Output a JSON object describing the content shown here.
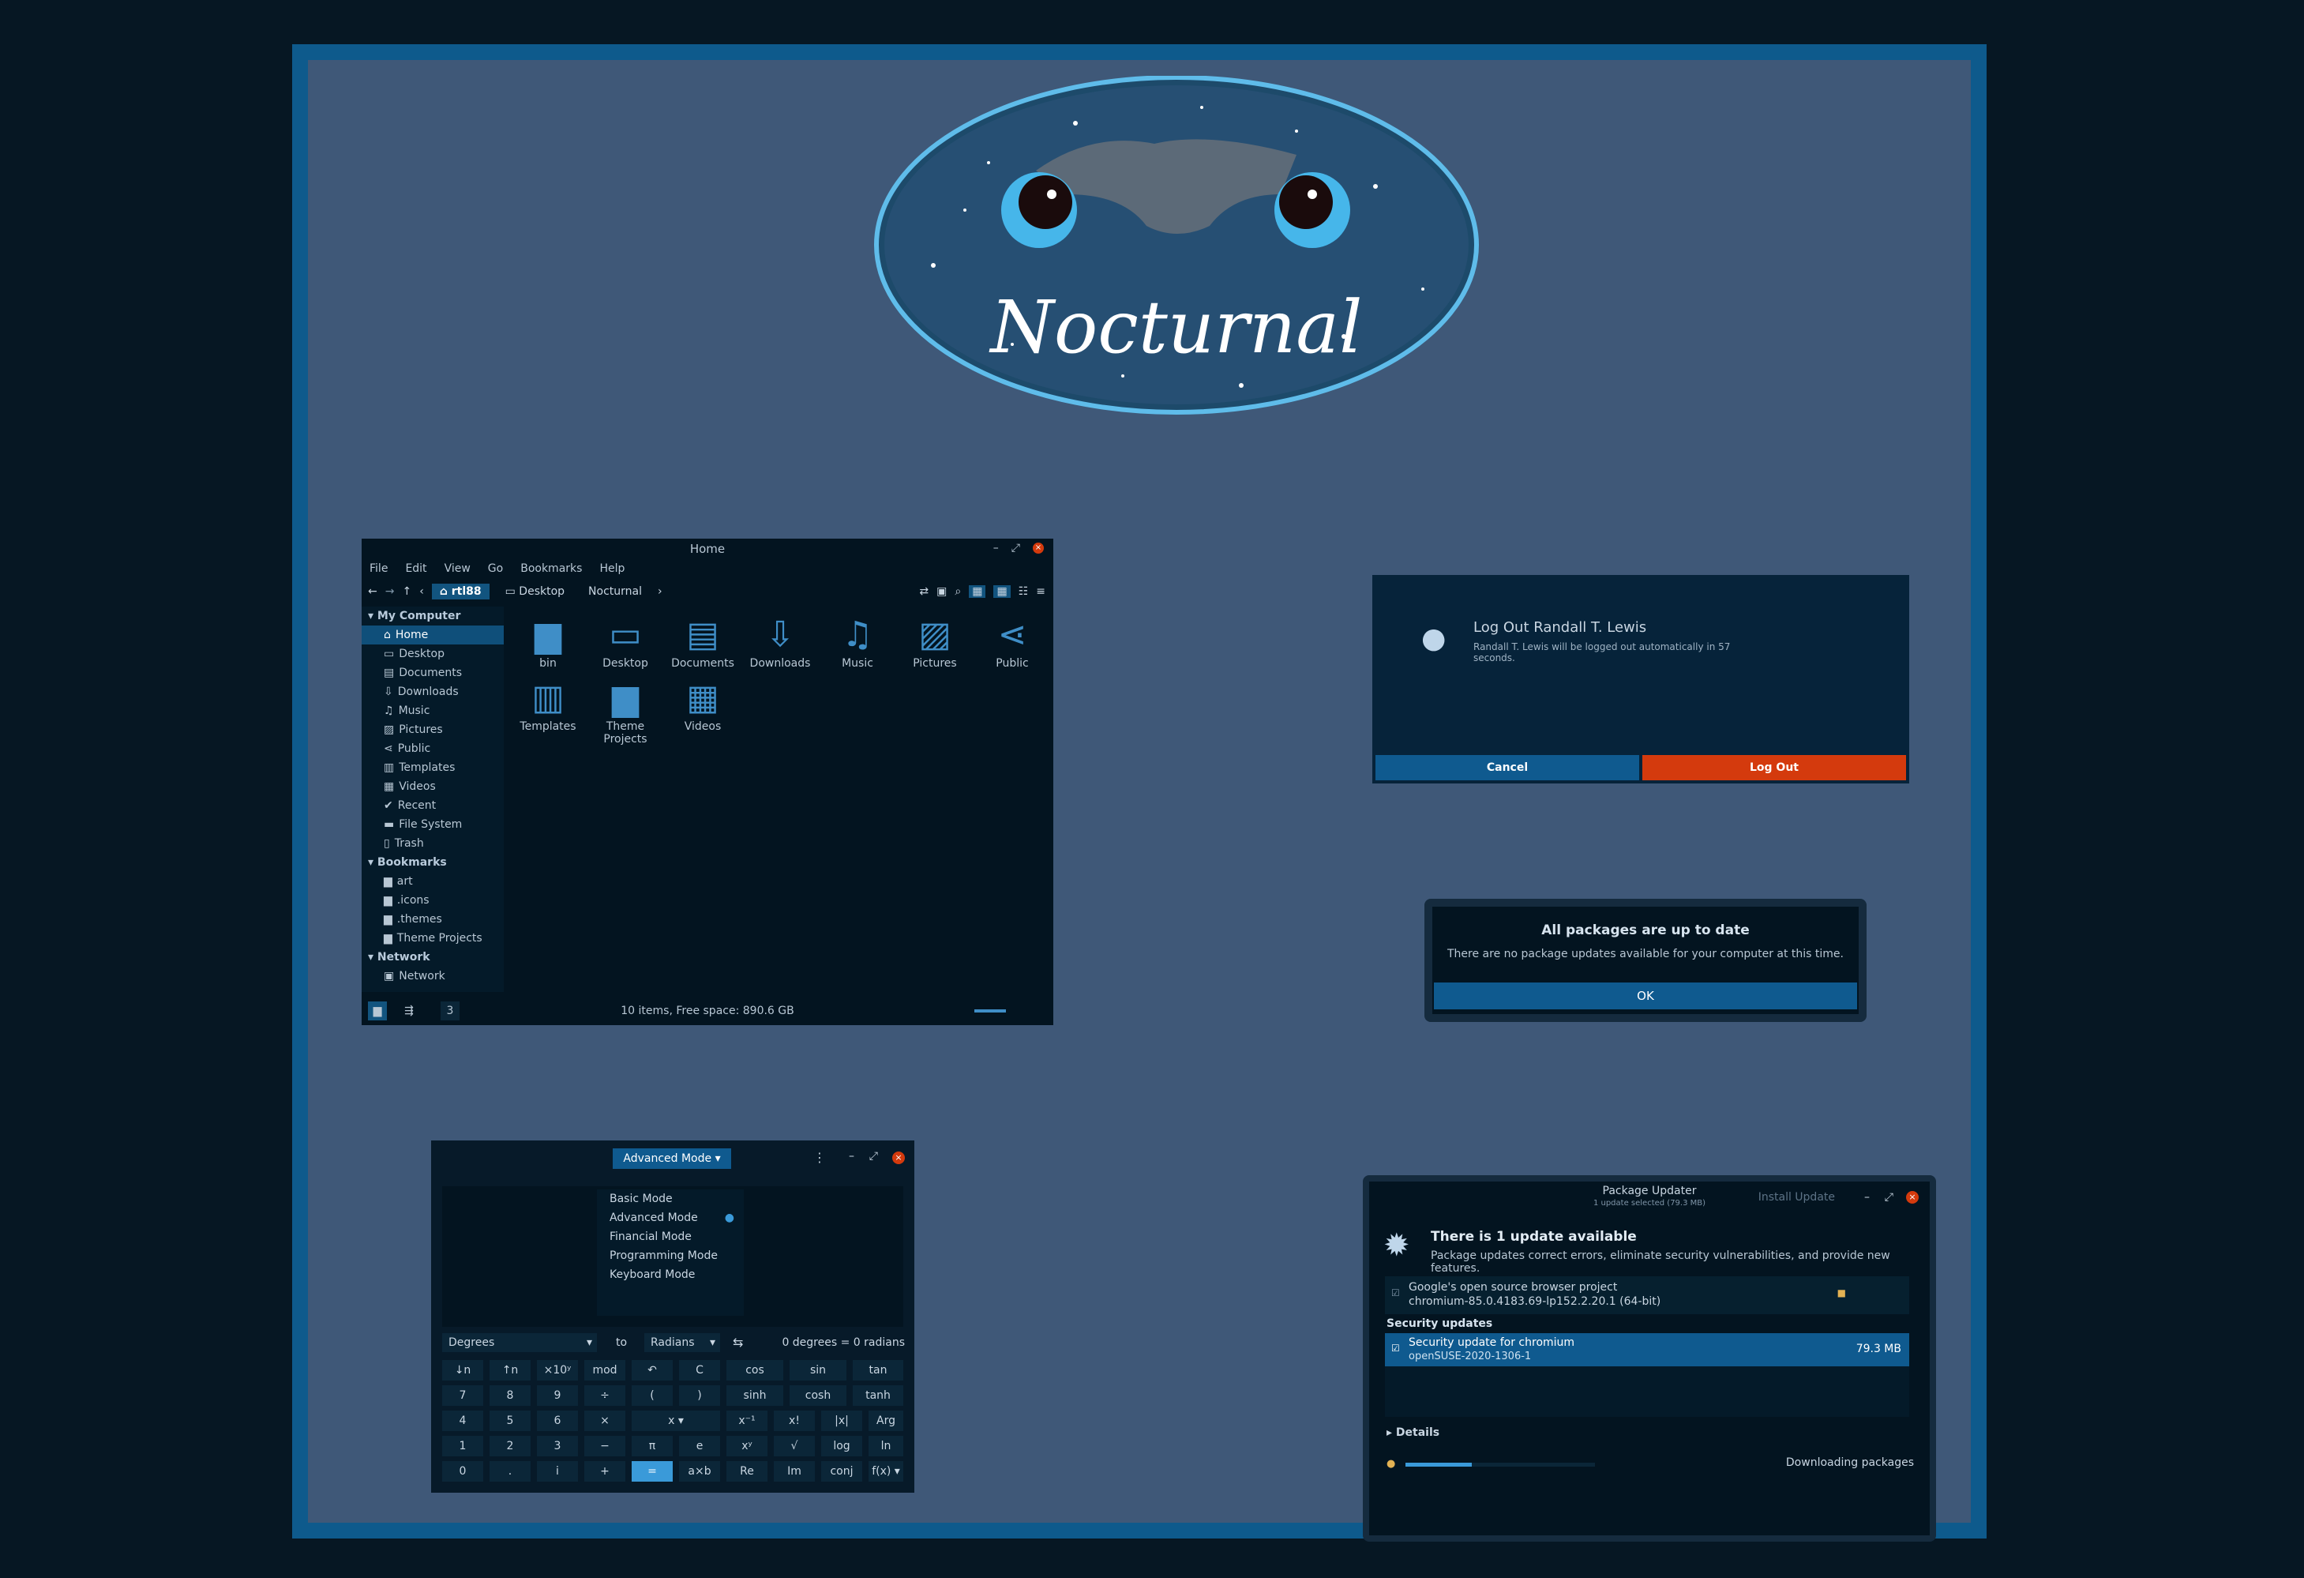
{
  "logo": {
    "text": "Nocturnal"
  },
  "file_manager": {
    "title": "Home",
    "menu": [
      "File",
      "Edit",
      "View",
      "Go",
      "Bookmarks",
      "Help"
    ],
    "breadcrumbs": [
      "rtl88",
      "Desktop",
      "Nocturnal"
    ],
    "sidebar": {
      "sections": [
        {
          "title": "My Computer",
          "items": [
            "Home",
            "Desktop",
            "Documents",
            "Downloads",
            "Music",
            "Pictures",
            "Public",
            "Templates",
            "Videos",
            "Recent",
            "File System",
            "Trash"
          ]
        },
        {
          "title": "Bookmarks",
          "items": [
            "art",
            ".icons",
            ".themes",
            "Theme Projects"
          ]
        },
        {
          "title": "Network",
          "items": [
            "Network"
          ]
        }
      ]
    },
    "icons": [
      "bin",
      "Desktop",
      "Documents",
      "Downloads",
      "Music",
      "Pictures",
      "Public",
      "Templates",
      "Theme Projects",
      "Videos"
    ],
    "status": "10 items, Free space: 890.6 GB",
    "status_tab": "3"
  },
  "logout": {
    "title": "Log Out Randall T. Lewis",
    "message": "Randall T. Lewis will be logged out automatically in 57 seconds.",
    "cancel": "Cancel",
    "logout": "Log Out",
    "colors": {
      "cancel": "#0f5a8f",
      "logout": "#d43a0d"
    }
  },
  "uptodate": {
    "title": "All packages are up to date",
    "message": "There are no package updates available for your computer at this time.",
    "ok": "OK"
  },
  "calculator": {
    "mode": "Advanced Mode",
    "modes": [
      "Basic Mode",
      "Advanced Mode",
      "Financial Mode",
      "Programming Mode",
      "Keyboard Mode"
    ],
    "from_unit": "Degrees",
    "to": "to",
    "to_unit": "Radians",
    "conversion": "0 degrees = 0 radians",
    "keys": [
      [
        "↓n",
        "↑n",
        "×10ʸ",
        "mod",
        "↶",
        "C",
        "cos",
        "sin",
        "tan"
      ],
      [
        "7",
        "8",
        "9",
        "÷",
        "(",
        ")",
        "sinh",
        "cosh",
        "tanh"
      ],
      [
        "4",
        "5",
        "6",
        "×",
        "x ▾",
        "",
        "x⁻¹",
        "x!",
        "|x|",
        "Arg"
      ],
      [
        "1",
        "2",
        "3",
        "−",
        "π",
        "e",
        "xʸ",
        "√",
        "log",
        "ln"
      ],
      [
        "0",
        ".",
        "i",
        "+",
        "=",
        "a×b",
        "Re",
        "Im",
        "conj",
        "f(x) ▾"
      ]
    ]
  },
  "package_updater": {
    "title": "Package Updater",
    "subtitle": "1 update selected (79.3 MB)",
    "install": "Install Update",
    "heading": "There is 1 update available",
    "description": "Package updates correct errors, eliminate security vulnerabilities, and provide new features.",
    "package1_name": "Google's open source browser project",
    "package1_version": "chromium-85.0.4183.69-lp152.2.20.1 (64-bit)",
    "section": "Security updates",
    "update_name": "Security update for chromium",
    "update_id": "openSUSE-2020-1306-1",
    "update_size": "79.3 MB",
    "details": "Details",
    "progress_label": "Downloading packages",
    "progress": 0.35
  }
}
